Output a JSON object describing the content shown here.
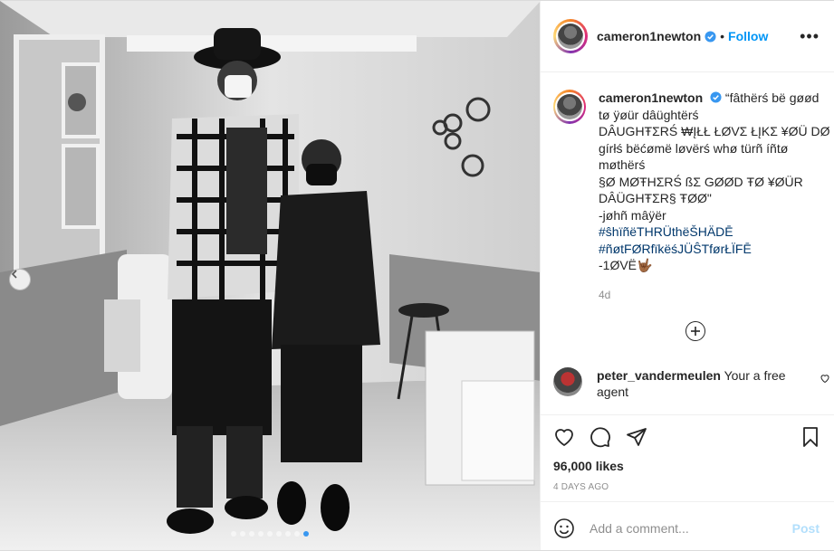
{
  "post": {
    "author": "cameron1newton",
    "follow_label": "Follow",
    "separator": "•",
    "more_label": "•••",
    "caption_lines": [
      "“fâthërś bë gøød",
      "tø ÿøür dâüghtërś",
      "DÂUGHŦΣRŚ ₩ĮŁŁ ŁØVΣ ŁĮKΣ ¥ØÜ DØ",
      "gírłś bëćømë løvërś whø türñ íñtø",
      "møthërś",
      "§Ø MØŦHΣRŚ ßΣ GØØD ŦØ ¥ØÜR",
      "DÂÜGHŦΣR§ ŦØØ\"",
      "-jøhñ mâÿër"
    ],
    "hashtags": [
      "#ŝhïñëTHRÜthëŠHÄDĒ",
      "#ñøtFØRfïkëśJÜŜTførŁÏFĒ"
    ],
    "signoff": "-1ØVË🤟🏾",
    "caption_time": "4d",
    "comment": {
      "user": "peter_vandermeulen",
      "text": "Your a free agent"
    },
    "likes": "96,000 likes",
    "posted_ago": "4 DAYS AGO",
    "add_comment_placeholder": "Add a comment...",
    "post_button": "Post",
    "carousel": {
      "count": 9,
      "active_index": 8
    }
  },
  "colors": {
    "link": "#0095f6",
    "hashtag": "#00376b",
    "muted": "#8e8e8e"
  },
  "icons": [
    "verified-icon",
    "more-icon",
    "add-circle-icon",
    "heart-icon",
    "comment-icon",
    "share-icon",
    "bookmark-icon",
    "emoji-icon",
    "chevron-left-icon"
  ]
}
